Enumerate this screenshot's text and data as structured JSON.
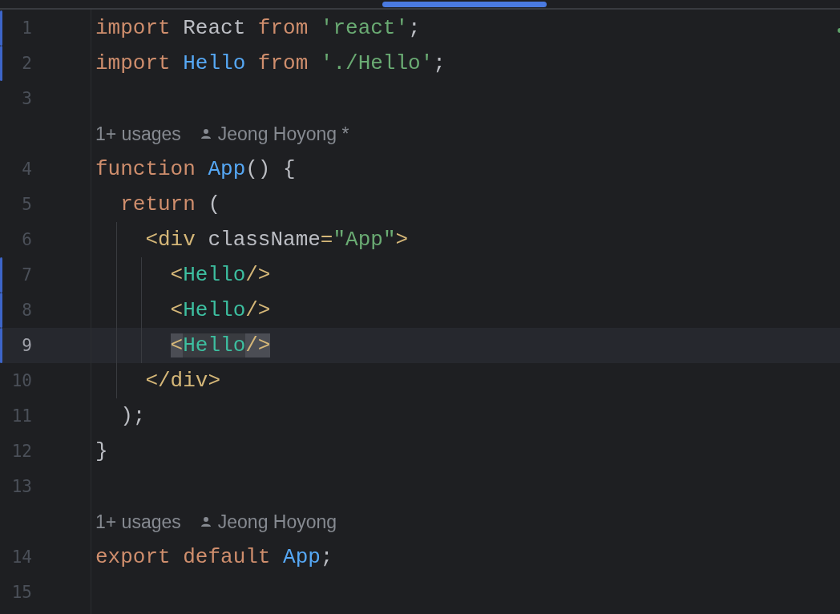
{
  "editor": {
    "lines": [
      {
        "kind": "code",
        "number": "1",
        "modified": true,
        "selected": false,
        "tokens": [
          {
            "text": "import ",
            "kind": "keyword"
          },
          {
            "text": "React ",
            "kind": "plain"
          },
          {
            "text": "from ",
            "kind": "keyword"
          },
          {
            "text": "'react'",
            "kind": "string"
          },
          {
            "text": ";",
            "kind": "plain"
          }
        ]
      },
      {
        "kind": "code",
        "number": "2",
        "modified": true,
        "selected": false,
        "tokens": [
          {
            "text": "import ",
            "kind": "keyword"
          },
          {
            "text": "Hello ",
            "kind": "identifier"
          },
          {
            "text": "from ",
            "kind": "keyword"
          },
          {
            "text": "'./Hello'",
            "kind": "string"
          },
          {
            "text": ";",
            "kind": "plain"
          }
        ]
      },
      {
        "kind": "code",
        "number": "3",
        "modified": false,
        "selected": false
      },
      {
        "kind": "hint",
        "usages": "1+ usages",
        "author": "Jeong Hoyong *"
      },
      {
        "kind": "code",
        "number": "4",
        "modified": false,
        "selected": false,
        "tokens": [
          {
            "text": "function ",
            "kind": "keyword"
          },
          {
            "text": "App",
            "kind": "identifier"
          },
          {
            "text": "() {",
            "kind": "plain"
          }
        ],
        "children": [
          {
            "kind": "code",
            "number": "5",
            "modified": false,
            "selected": false,
            "tokens": [
              {
                "text": "return ",
                "kind": "keyword"
              },
              {
                "text": "(",
                "kind": "plain"
              }
            ],
            "children": [
              {
                "kind": "code",
                "number": "6",
                "modified": false,
                "selected": false,
                "tokens": [
                  {
                    "text": "<div ",
                    "kind": "tag"
                  },
                  {
                    "text": "className",
                    "kind": "plain"
                  },
                  {
                    "text": "=",
                    "kind": "tag"
                  },
                  {
                    "text": "\"App\"",
                    "kind": "string"
                  },
                  {
                    "text": ">",
                    "kind": "tag"
                  }
                ],
                "children": [
                  {
                    "kind": "code",
                    "number": "7",
                    "modified": true,
                    "selected": false,
                    "tokens": [
                      {
                        "text": "<",
                        "kind": "tag"
                      },
                      {
                        "text": "Hello",
                        "kind": "component"
                      },
                      {
                        "text": "/>",
                        "kind": "tag"
                      }
                    ]
                  },
                  {
                    "kind": "code",
                    "number": "8",
                    "modified": true,
                    "selected": false,
                    "tokens": [
                      {
                        "text": "<",
                        "kind": "tag"
                      },
                      {
                        "text": "Hello",
                        "kind": "component"
                      },
                      {
                        "text": "/>",
                        "kind": "tag"
                      }
                    ]
                  },
                  {
                    "kind": "code",
                    "number": "9",
                    "modified": true,
                    "selected": true,
                    "tokens": [
                      {
                        "text": "<",
                        "kind": "tag",
                        "matched": true
                      },
                      {
                        "text": "Hello",
                        "kind": "component",
                        "matched": false
                      },
                      {
                        "text": "/>",
                        "kind": "tag",
                        "matched": true
                      }
                    ]
                  }
                ]
              },
              {
                "kind": "code",
                "number": "10",
                "modified": false,
                "selected": false,
                "tokens": [
                  {
                    "text": "</div>",
                    "kind": "tag"
                  }
                ]
              }
            ]
          },
          {
            "kind": "code",
            "number": "11",
            "modified": false,
            "selected": false,
            "tokens": [
              {
                "text": ");",
                "kind": "plain"
              }
            ]
          }
        ]
      },
      {
        "kind": "code",
        "number": "12",
        "modified": false,
        "selected": false,
        "tokens": [
          {
            "text": "}",
            "kind": "plain"
          }
        ]
      },
      {
        "kind": "code",
        "number": "13",
        "modified": false,
        "selected": false
      },
      {
        "kind": "hint",
        "usages": "1+ usages",
        "author": "Jeong Hoyong"
      },
      {
        "kind": "code",
        "number": "14",
        "modified": false,
        "selected": false,
        "tokens": [
          {
            "text": "export ",
            "kind": "keyword"
          },
          {
            "text": "default ",
            "kind": "keyword"
          },
          {
            "text": "App",
            "kind": "identifier"
          },
          {
            "text": ";",
            "kind": "plain"
          }
        ]
      },
      {
        "kind": "code",
        "number": "15",
        "modified": false,
        "selected": false
      }
    ]
  }
}
